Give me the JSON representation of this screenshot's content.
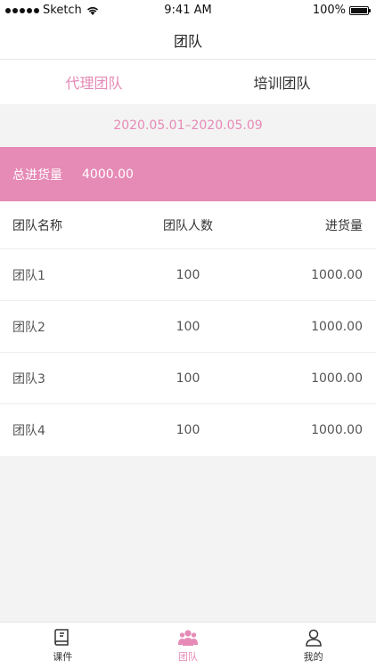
{
  "status_bar": {
    "carrier": "Sketch",
    "time": "9:41 AM",
    "battery": "100%"
  },
  "nav": {
    "title": "团队"
  },
  "tabs": [
    {
      "label": "代理团队",
      "active": true
    },
    {
      "label": "培训团队",
      "active": false
    }
  ],
  "date_range": "2020.05.01–2020.05.09",
  "summary": {
    "label": "总进货量",
    "value": "4000.00"
  },
  "table": {
    "headers": [
      "团队名称",
      "团队人数",
      "进货量"
    ],
    "rows": [
      {
        "name": "团队1",
        "count": "100",
        "volume": "1000.00"
      },
      {
        "name": "团队2",
        "count": "100",
        "volume": "1000.00"
      },
      {
        "name": "团队3",
        "count": "100",
        "volume": "1000.00"
      },
      {
        "name": "团队4",
        "count": "100",
        "volume": "1000.00"
      }
    ]
  },
  "tab_bar": [
    {
      "label": "课件",
      "icon": "book-icon",
      "active": false
    },
    {
      "label": "团队",
      "icon": "team-icon",
      "active": true
    },
    {
      "label": "我的",
      "icon": "user-icon",
      "active": false
    }
  ],
  "colors": {
    "accent": "#e68ab6",
    "background": "#f3f3f3"
  }
}
